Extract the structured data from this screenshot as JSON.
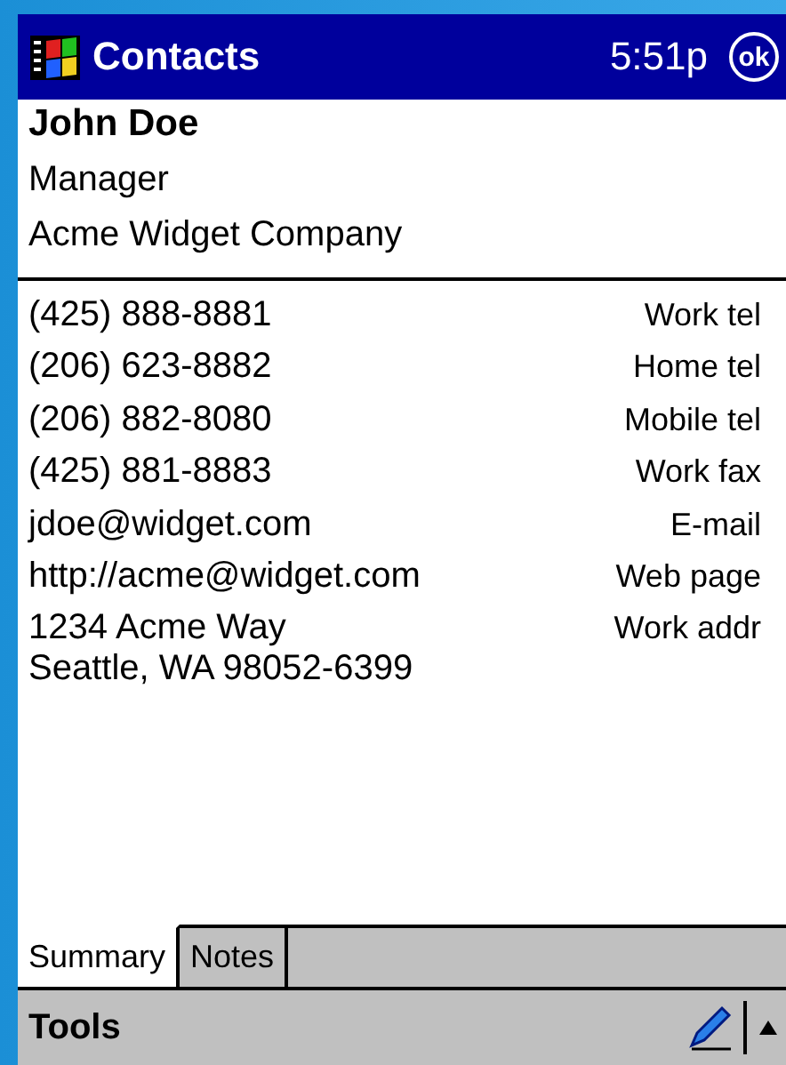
{
  "title_bar": {
    "title": "Contacts",
    "time": "5:51p",
    "ok_button": "ok"
  },
  "contact": {
    "name": "John Doe",
    "job_title": "Manager",
    "company": "Acme Widget Company"
  },
  "fields": [
    {
      "value": "(425) 888-8881",
      "label": "Work tel"
    },
    {
      "value": "(206) 623-8882",
      "label": "Home tel"
    },
    {
      "value": "(206) 882-8080",
      "label": "Mobile tel"
    },
    {
      "value": "(425) 881-8883",
      "label": "Work fax"
    },
    {
      "value": "jdoe@widget.com",
      "label": "E-mail"
    },
    {
      "value": "http://acme@widget.com",
      "label": "Web page"
    },
    {
      "value": "1234 Acme Way\nSeattle, WA 98052-6399",
      "label": "Work addr"
    }
  ],
  "tabs": [
    {
      "label": "Summary",
      "selected": true
    },
    {
      "label": "Notes",
      "selected": false
    }
  ],
  "menu_bar": {
    "items": [
      "Tools"
    ]
  }
}
